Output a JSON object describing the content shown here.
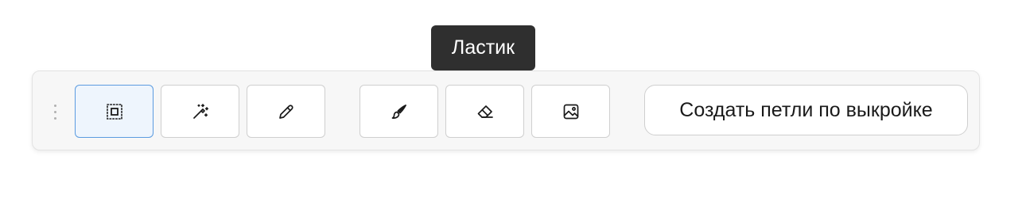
{
  "toolbar": {
    "tools": [
      {
        "id": "select",
        "icon": "select-region-icon",
        "active": true
      },
      {
        "id": "magic-wand",
        "icon": "magic-wand-icon",
        "active": false
      },
      {
        "id": "pencil",
        "icon": "pencil-icon",
        "active": false
      },
      {
        "id": "brush",
        "icon": "brush-icon",
        "active": false
      },
      {
        "id": "eraser",
        "icon": "eraser-icon",
        "active": false
      },
      {
        "id": "image",
        "icon": "image-icon",
        "active": false
      }
    ],
    "action_label": "Создать петли по выкройке"
  },
  "tooltip": {
    "text": "Ластик"
  },
  "colors": {
    "active_border": "#5b9be0",
    "active_bg": "#eef5fd",
    "tooltip_bg": "#2f2f2f"
  }
}
